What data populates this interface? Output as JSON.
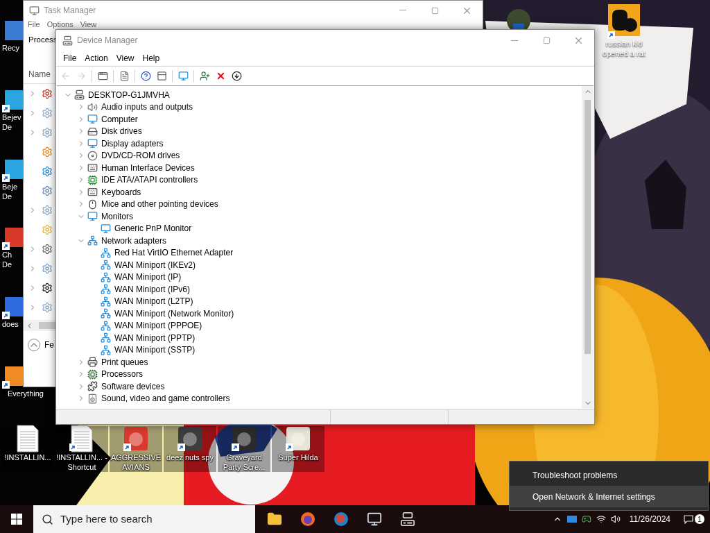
{
  "desktop_icons_left": [
    {
      "label": "Recy"
    },
    {
      "label": "Bejev De"
    },
    {
      "label": "Beje De"
    },
    {
      "label": "Ch De"
    },
    {
      "label": "does"
    },
    {
      "label": "Everything"
    }
  ],
  "desktop_icons_top": [
    {
      "label": "russian kid opened a rat"
    }
  ],
  "desktop_icons_bottom": [
    {
      "label": "!INSTALLIN..."
    },
    {
      "label": "!INSTALLIN... - Shortcut"
    },
    {
      "label": "AGGRESSIVE AVIANS"
    },
    {
      "label": "deez nuts spy"
    },
    {
      "label": "Graveyard Party Scre..."
    },
    {
      "label": "Super Hilda"
    }
  ],
  "task_manager": {
    "title": "Task Manager",
    "menu": [
      "File",
      "Options",
      "View"
    ],
    "tab": "Process",
    "column": "Name",
    "footer": "Fe",
    "rows": [
      {
        "has_children": true
      },
      {
        "has_children": true
      },
      {
        "has_children": true
      },
      {
        "has_children": false
      },
      {
        "has_children": false
      },
      {
        "has_children": false
      },
      {
        "has_children": true
      },
      {
        "has_children": false
      },
      {
        "has_children": true
      },
      {
        "has_children": true
      },
      {
        "has_children": true
      },
      {
        "has_children": true
      }
    ]
  },
  "device_manager": {
    "title": "Device Manager",
    "menu": [
      "File",
      "Action",
      "View",
      "Help"
    ],
    "toolbar": [
      {
        "disabled": true
      },
      {
        "disabled": true
      },
      {
        "disabled": false
      },
      {
        "disabled": false
      },
      {
        "disabled": false
      },
      {
        "disabled": false
      },
      {
        "disabled": false
      },
      {
        "disabled": false
      },
      {
        "disabled": false
      },
      {
        "disabled": false
      }
    ],
    "tree": {
      "label": "DESKTOP-G1JMVHA",
      "expanded": true,
      "children": [
        {
          "label": "Audio inputs and outputs",
          "expanded": false
        },
        {
          "label": "Computer",
          "expanded": false
        },
        {
          "label": "Disk drives",
          "expanded": false
        },
        {
          "label": "Display adapters",
          "expanded": false
        },
        {
          "label": "DVD/CD-ROM drives",
          "expanded": false
        },
        {
          "label": "Human Interface Devices",
          "expanded": false
        },
        {
          "label": "IDE ATA/ATAPI controllers",
          "expanded": false
        },
        {
          "label": "Keyboards",
          "expanded": false
        },
        {
          "label": "Mice and other pointing devices",
          "expanded": false
        },
        {
          "label": "Monitors",
          "expanded": true,
          "children": [
            {
              "label": "Generic PnP Monitor"
            }
          ]
        },
        {
          "label": "Network adapters",
          "expanded": true,
          "children": [
            {
              "label": "Red Hat VirtIO Ethernet Adapter"
            },
            {
              "label": "WAN Miniport (IKEv2)"
            },
            {
              "label": "WAN Miniport (IP)"
            },
            {
              "label": "WAN Miniport (IPv6)"
            },
            {
              "label": "WAN Miniport (L2TP)"
            },
            {
              "label": "WAN Miniport (Network Monitor)"
            },
            {
              "label": "WAN Miniport (PPPOE)"
            },
            {
              "label": "WAN Miniport (PPTP)"
            },
            {
              "label": "WAN Miniport (SSTP)"
            }
          ]
        },
        {
          "label": "Print queues",
          "expanded": false
        },
        {
          "label": "Processors",
          "expanded": false
        },
        {
          "label": "Software devices",
          "expanded": false
        },
        {
          "label": "Sound, video and game controllers",
          "expanded": false
        }
      ]
    }
  },
  "context_menu": [
    {
      "label": "Troubleshoot problems",
      "selected": false
    },
    {
      "label": "Open Network & Internet settings",
      "selected": true
    }
  ],
  "taskbar": {
    "search_placeholder": "Type here to search",
    "date": "11/26/2024",
    "notifications": "1"
  }
}
